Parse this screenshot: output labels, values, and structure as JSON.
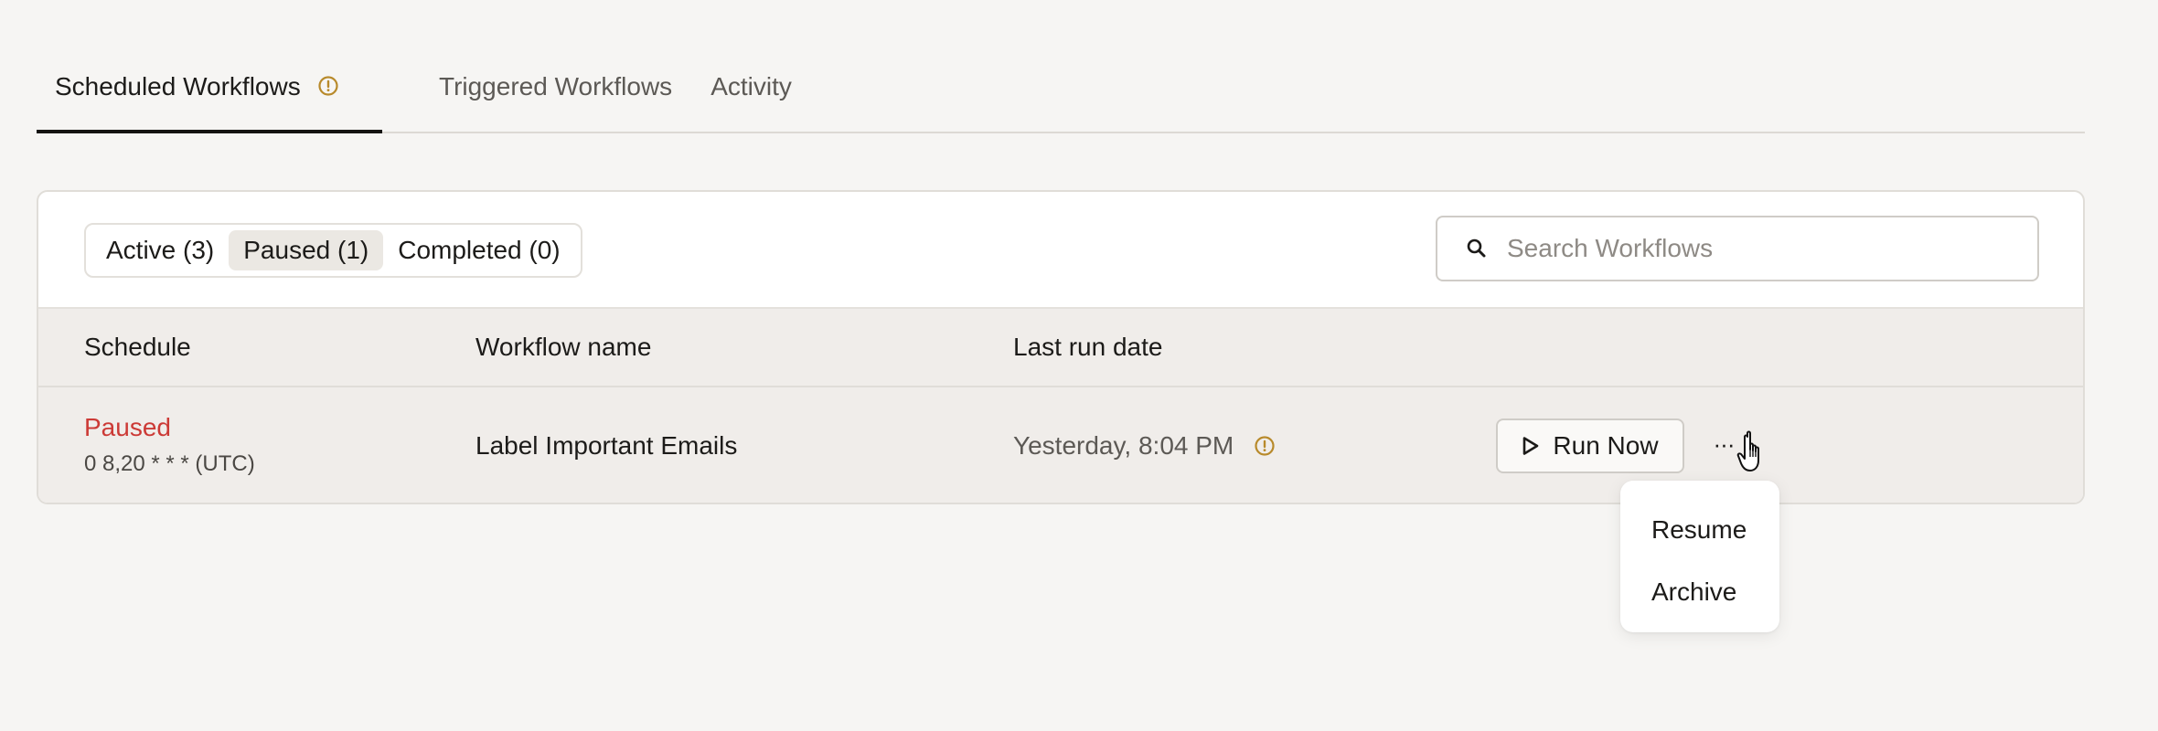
{
  "tabs": [
    {
      "label": "Scheduled Workflows",
      "active": true,
      "icon": "warning-icon"
    },
    {
      "label": "Triggered Workflows",
      "active": false
    },
    {
      "label": "Activity",
      "active": false
    }
  ],
  "filters": [
    {
      "label": "Active (3)",
      "selected": false
    },
    {
      "label": "Paused (1)",
      "selected": true
    },
    {
      "label": "Completed (0)",
      "selected": false
    }
  ],
  "search": {
    "placeholder": "Search Workflows",
    "value": ""
  },
  "table": {
    "columns": [
      "Schedule",
      "Workflow name",
      "Last run date"
    ],
    "rows": [
      {
        "status": "Paused",
        "cron": "0 8,20 * * * (UTC)",
        "name": "Label Important Emails",
        "last_run": "Yesterday, 8:04 PM",
        "run_label": "Run Now",
        "more_label": "···"
      }
    ]
  },
  "menu": {
    "items": [
      "Resume",
      "Archive"
    ]
  },
  "colors": {
    "background": "#f6f5f3",
    "paused_red": "#cc3a36",
    "warning_gold": "#b88a2b",
    "active_tab_underline": "#141311"
  }
}
